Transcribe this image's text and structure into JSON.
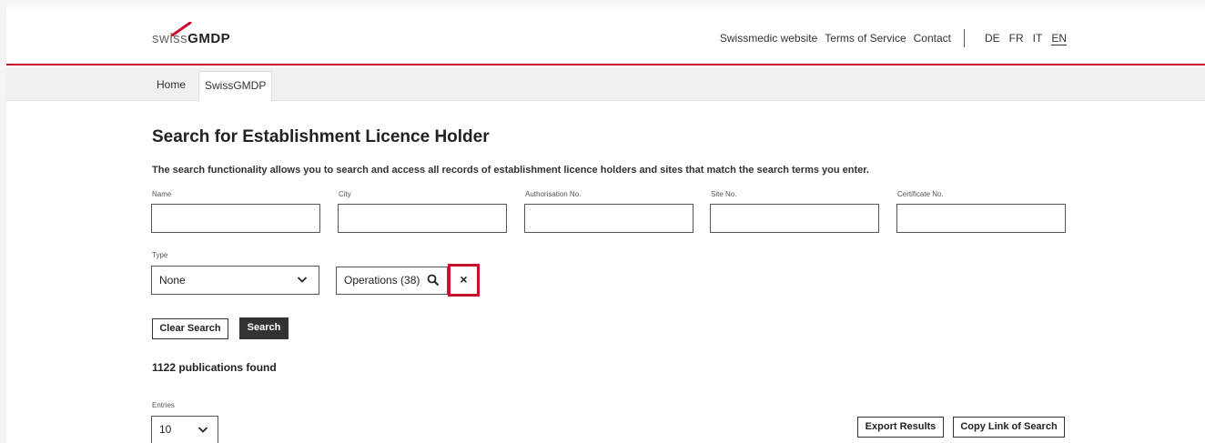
{
  "header": {
    "logo_light": "swiss",
    "logo_bold": "GMDP",
    "links": [
      "Swissmedic website",
      "Terms of Service",
      "Contact"
    ],
    "languages": [
      "DE",
      "FR",
      "IT",
      "EN"
    ],
    "active_language": "EN",
    "accent": "#c8102e"
  },
  "nav": {
    "home": "Home",
    "current": "SwissGMDP"
  },
  "main": {
    "title": "Search for Establishment Licence Holder",
    "description": "The search functionality allows you to search and access all records of establishment licence holders and sites that match the search terms you enter."
  },
  "fields": {
    "name_label": "Name",
    "city_label": "City",
    "auth_label": "Authorisation No.",
    "site_label": "Site No.",
    "cert_label": "Certificate No.",
    "type_label": "Type",
    "type_value": "None",
    "operations_label": "Operations (38)",
    "clear_icon": "×"
  },
  "buttons": {
    "clear_search": "Clear Search",
    "search": "Search",
    "export": "Export Results",
    "copy_link": "Copy Link of Search"
  },
  "results": {
    "found": "1122 publications found",
    "entries_label": "Entries",
    "entries_value": "10"
  }
}
